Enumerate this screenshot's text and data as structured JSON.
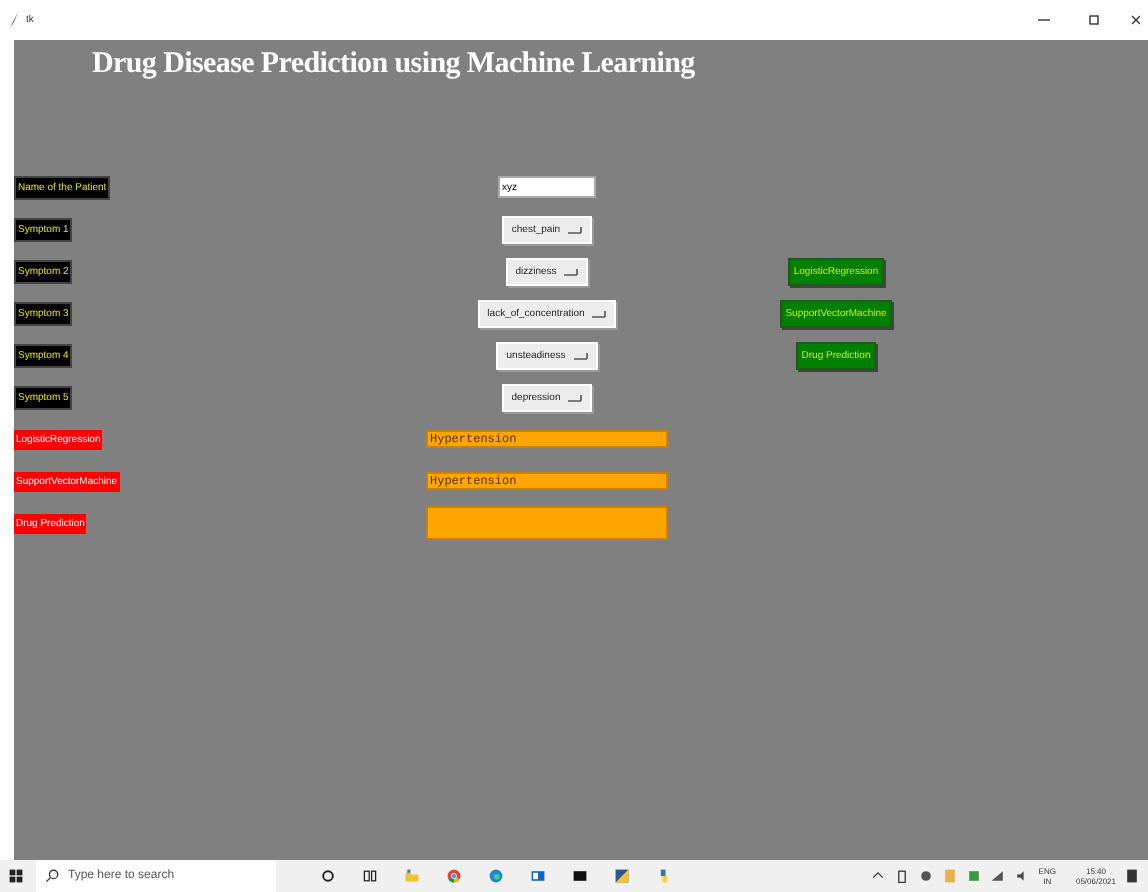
{
  "window": {
    "title": "tk"
  },
  "heading": "Drug Disease Prediction using Machine Learning",
  "patient": {
    "label": "Name of the Patient",
    "value": "xyz"
  },
  "symptoms": [
    {
      "label": "Symptom 1",
      "value": "chest_pain"
    },
    {
      "label": "Symptom 2",
      "value": "dizziness"
    },
    {
      "label": "Symptom 3",
      "value": "lack_of_concentration"
    },
    {
      "label": "Symptom 4",
      "value": "unsteadiness"
    },
    {
      "label": "Symptom 5",
      "value": "depression"
    }
  ],
  "results": [
    {
      "label": "LogisticRegression",
      "value": "Hypertension"
    },
    {
      "label": "SupportVectorMachine",
      "value": "Hypertension"
    },
    {
      "label": "Drug Prediction"
    }
  ],
  "actions": [
    {
      "label": "LogisticRegression"
    },
    {
      "label": "SupportVectorMachine"
    },
    {
      "label": "Drug Prediction"
    }
  ],
  "taskbar": {
    "search_placeholder": "Type here to search",
    "language": "ENG",
    "region": "IN",
    "time": "15:40",
    "date": "05/06/2021"
  }
}
